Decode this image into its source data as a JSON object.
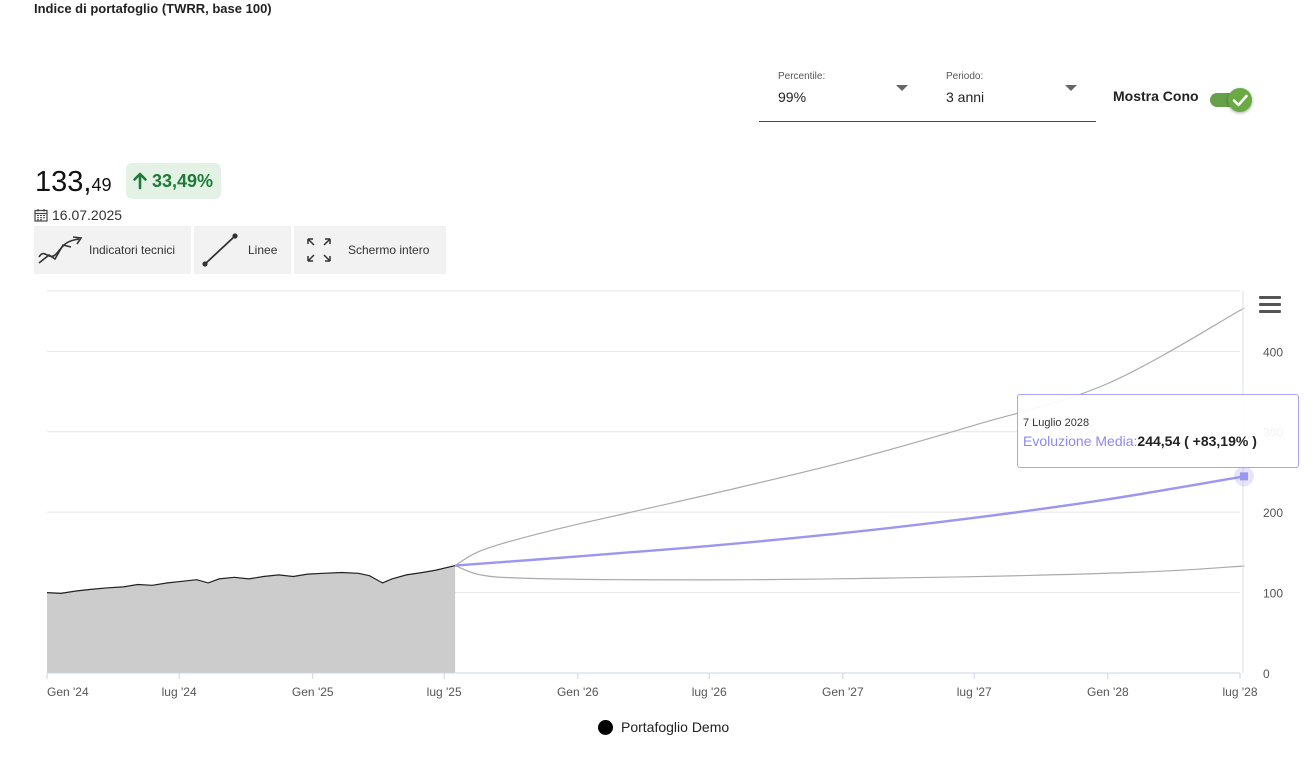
{
  "page": {
    "title": "Indice di portafoglio (TWRR, base 100)"
  },
  "controls": {
    "percentile": {
      "label": "Percentile:",
      "value": "99%"
    },
    "period": {
      "label": "Periodo:",
      "value": "3 anni"
    },
    "cone_toggle": {
      "label": "Mostra Cono",
      "on": true
    }
  },
  "summary": {
    "value_int": "133,",
    "value_dec": "49",
    "change": "33,49%",
    "change_direction": "up",
    "date": "16.07.2025"
  },
  "toolbar": {
    "indicators": "Indicatori tecnici",
    "lines": "Linee",
    "fullscreen": "Schermo intero"
  },
  "tooltip": {
    "date": "7 Luglio 2028",
    "series": "Evoluzione Media",
    "value": "244,54 ( +83,19% )"
  },
  "legend": {
    "label": "Portafoglio Demo"
  },
  "colors": {
    "history_fill": "#cccccc",
    "history_line": "#222222",
    "mean_line": "#9b96f2",
    "cone_line": "#aaaaaa",
    "up_green": "#1e7a37"
  },
  "chart_data": {
    "type": "line",
    "x_type": "date",
    "x_range": [
      "2024-01-01",
      "2028-07-01"
    ],
    "y_range": [
      0,
      475
    ],
    "grid": "horizontal",
    "legend_position": "bottom-center",
    "y_ticks": [
      {
        "value": 0,
        "label": "0"
      },
      {
        "value": 100,
        "label": "100"
      },
      {
        "value": 200,
        "label": "200"
      },
      {
        "value": 300,
        "label": "300"
      },
      {
        "value": 400,
        "label": "400"
      }
    ],
    "x_ticks": [
      {
        "date": "2024-01-01",
        "label": "Gen '24"
      },
      {
        "date": "2024-07-01",
        "label": "lug '24"
      },
      {
        "date": "2025-01-01",
        "label": "Gen '25"
      },
      {
        "date": "2025-07-01",
        "label": "lug '25"
      },
      {
        "date": "2026-01-01",
        "label": "Gen '26"
      },
      {
        "date": "2026-07-01",
        "label": "lug '26"
      },
      {
        "date": "2027-01-01",
        "label": "Gen '27"
      },
      {
        "date": "2027-07-01",
        "label": "lug '27"
      },
      {
        "date": "2028-01-01",
        "label": "Gen '28"
      },
      {
        "date": "2028-07-01",
        "label": "lug '28"
      }
    ],
    "series": [
      {
        "name": "Portafoglio Demo",
        "kind": "history-area",
        "points": [
          [
            "2024-01-01",
            100
          ],
          [
            "2024-01-20",
            99
          ],
          [
            "2024-02-10",
            102
          ],
          [
            "2024-03-01",
            104
          ],
          [
            "2024-03-25",
            106
          ],
          [
            "2024-04-15",
            107
          ],
          [
            "2024-05-05",
            110
          ],
          [
            "2024-05-25",
            109
          ],
          [
            "2024-06-15",
            112
          ],
          [
            "2024-07-05",
            114
          ],
          [
            "2024-07-25",
            116
          ],
          [
            "2024-08-10",
            112
          ],
          [
            "2024-08-25",
            117
          ],
          [
            "2024-09-15",
            119
          ],
          [
            "2024-10-05",
            117
          ],
          [
            "2024-10-25",
            120
          ],
          [
            "2024-11-15",
            122
          ],
          [
            "2024-12-05",
            120
          ],
          [
            "2024-12-25",
            123
          ],
          [
            "2025-01-15",
            124
          ],
          [
            "2025-02-10",
            125
          ],
          [
            "2025-03-05",
            124
          ],
          [
            "2025-03-20",
            121
          ],
          [
            "2025-04-07",
            112
          ],
          [
            "2025-04-20",
            117
          ],
          [
            "2025-05-10",
            122
          ],
          [
            "2025-06-01",
            125
          ],
          [
            "2025-06-20",
            128
          ],
          [
            "2025-07-16",
            133.49
          ]
        ]
      },
      {
        "name": "Evoluzione Media",
        "kind": "projection",
        "points": [
          [
            "2025-07-16",
            133.49
          ],
          [
            "2026-01-01",
            145
          ],
          [
            "2026-07-01",
            158
          ],
          [
            "2027-01-01",
            174
          ],
          [
            "2027-07-01",
            193
          ],
          [
            "2028-01-01",
            216
          ],
          [
            "2028-07-07",
            244.54
          ]
        ]
      },
      {
        "kind": "cone-upper",
        "points": [
          [
            "2025-07-16",
            133.49
          ],
          [
            "2025-08-15",
            150
          ],
          [
            "2025-10-01",
            164
          ],
          [
            "2026-01-01",
            185
          ],
          [
            "2026-07-01",
            222
          ],
          [
            "2027-01-01",
            262
          ],
          [
            "2027-07-01",
            308
          ],
          [
            "2028-01-01",
            360
          ],
          [
            "2028-07-07",
            454
          ]
        ]
      },
      {
        "kind": "cone-lower",
        "points": [
          [
            "2025-07-16",
            133.49
          ],
          [
            "2025-08-20",
            122
          ],
          [
            "2025-10-15",
            118
          ],
          [
            "2026-03-01",
            116
          ],
          [
            "2026-09-01",
            116
          ],
          [
            "2027-03-01",
            118
          ],
          [
            "2027-09-01",
            121
          ],
          [
            "2028-03-01",
            126
          ],
          [
            "2028-07-07",
            133
          ]
        ]
      }
    ]
  }
}
